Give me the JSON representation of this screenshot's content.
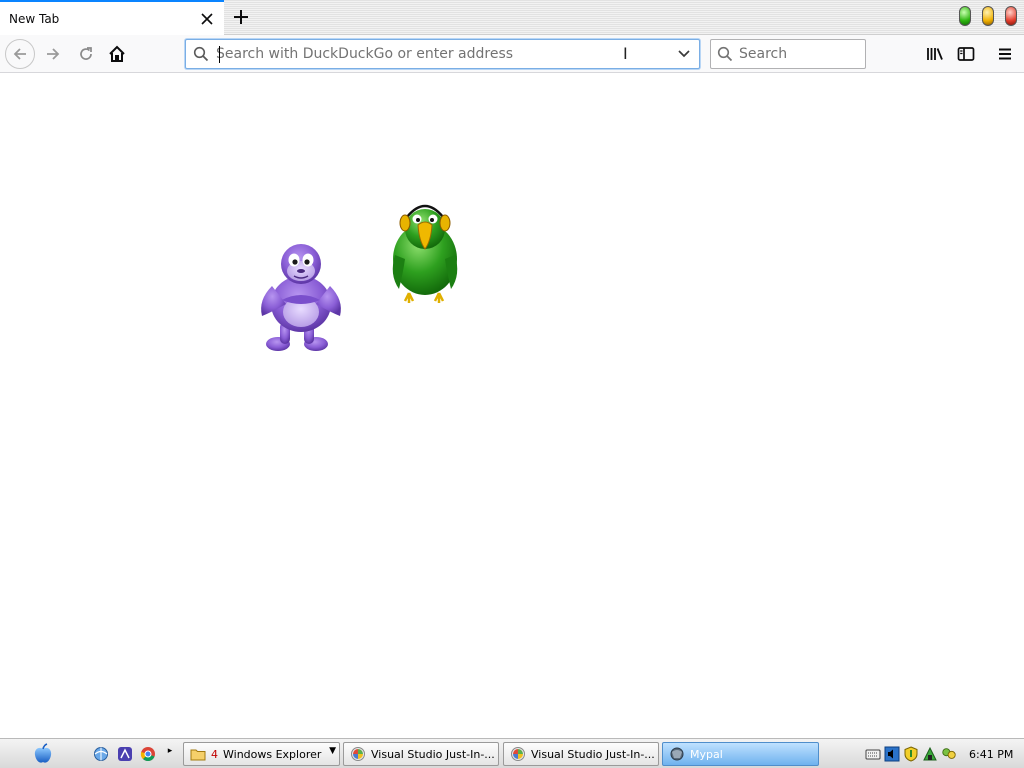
{
  "browser": {
    "tab": {
      "title": "New Tab",
      "close_glyph": "✕"
    },
    "newtab_glyph": "+",
    "window_lights": [
      "green",
      "yellow",
      "red"
    ],
    "nav": {
      "back_icon": "arrow-left-icon",
      "forward_icon": "arrow-right-icon",
      "reload_icon": "reload-icon",
      "home_icon": "home-icon"
    },
    "urlbar": {
      "placeholder": "Search with DuckDuckGo or enter address",
      "value": ""
    },
    "searchbar": {
      "placeholder": "Search",
      "value": ""
    },
    "toolbar_icons": [
      "library-icon",
      "sidebar-icon",
      "hamburger-menu-icon"
    ]
  },
  "content": {
    "characters": [
      "purple-gorilla",
      "green-parrot-with-headphones"
    ]
  },
  "taskbar": {
    "quick_launch": [
      "apple-icon",
      "internet-explorer-icon",
      "app-icon",
      "chrome-icon"
    ],
    "overflow_glyph": "▸",
    "tasks": [
      {
        "count": "4",
        "label": "Windows Explorer",
        "dropdown": "▼"
      },
      {
        "label": "Visual Studio Just-In-..."
      },
      {
        "label": "Visual Studio Just-In-..."
      },
      {
        "label": "Mypal",
        "active": true
      }
    ],
    "tray_icons": [
      "keyboard-icon",
      "volume-icon",
      "shield-icon",
      "network-icon",
      "chat-icon"
    ],
    "clock": "6:41 PM"
  },
  "colors": {
    "tab_accent": "#0a84ff",
    "urlbar_focus": "#7aaee5",
    "active_task": "#6fb2ee",
    "gorilla": "#8a5ed6",
    "parrot": "#2ea01f"
  }
}
